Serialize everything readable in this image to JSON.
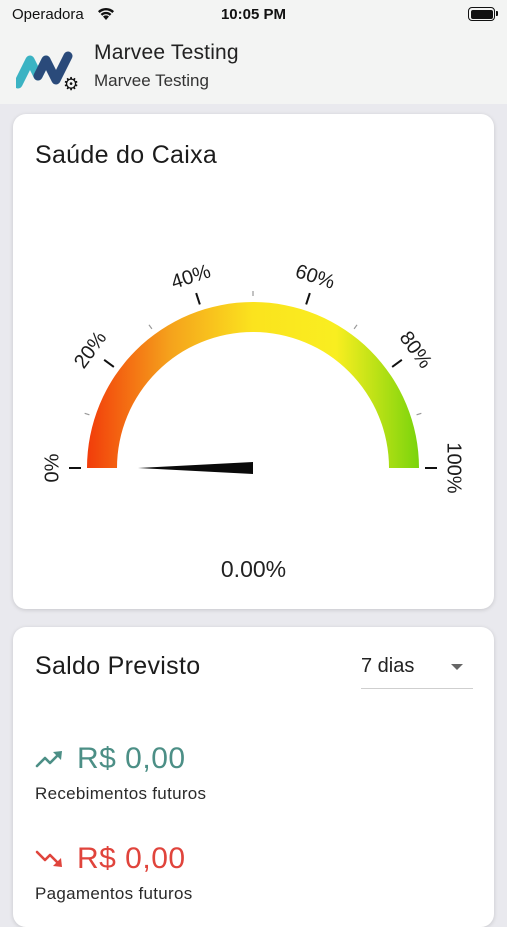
{
  "status_bar": {
    "carrier": "Operadora",
    "time": "10:05 PM",
    "icons": [
      "wifi-icon",
      "battery-icon"
    ]
  },
  "header": {
    "title": "Marvee Testing",
    "subtitle": "Marvee Testing",
    "icons": [
      "marvee-logo",
      "gear-icon"
    ]
  },
  "health_card": {
    "title": "Saúde do Caixa",
    "gauge": {
      "value": 0.0,
      "min": 0,
      "max": 100,
      "tick_labels": [
        "0%",
        "20%",
        "40%",
        "60%",
        "80%",
        "100%"
      ],
      "gradient_colors": [
        "#f23c0a",
        "#f5a21c",
        "#fbe31e",
        "#f9ee20",
        "#7ad40c"
      ]
    },
    "value_text": "0.00%"
  },
  "forecast_card": {
    "title": "Saldo Previsto",
    "period": {
      "selected": "7 dias"
    },
    "receipts": {
      "amount": "R$ 0,00",
      "label": "Recebimentos futuros",
      "icon": "trending-up-icon",
      "color": "#4c8f86"
    },
    "payments": {
      "amount": "R$ 0,00",
      "label": "Pagamentos futuros",
      "icon": "trending-down-icon",
      "color": "#e0443c"
    }
  }
}
